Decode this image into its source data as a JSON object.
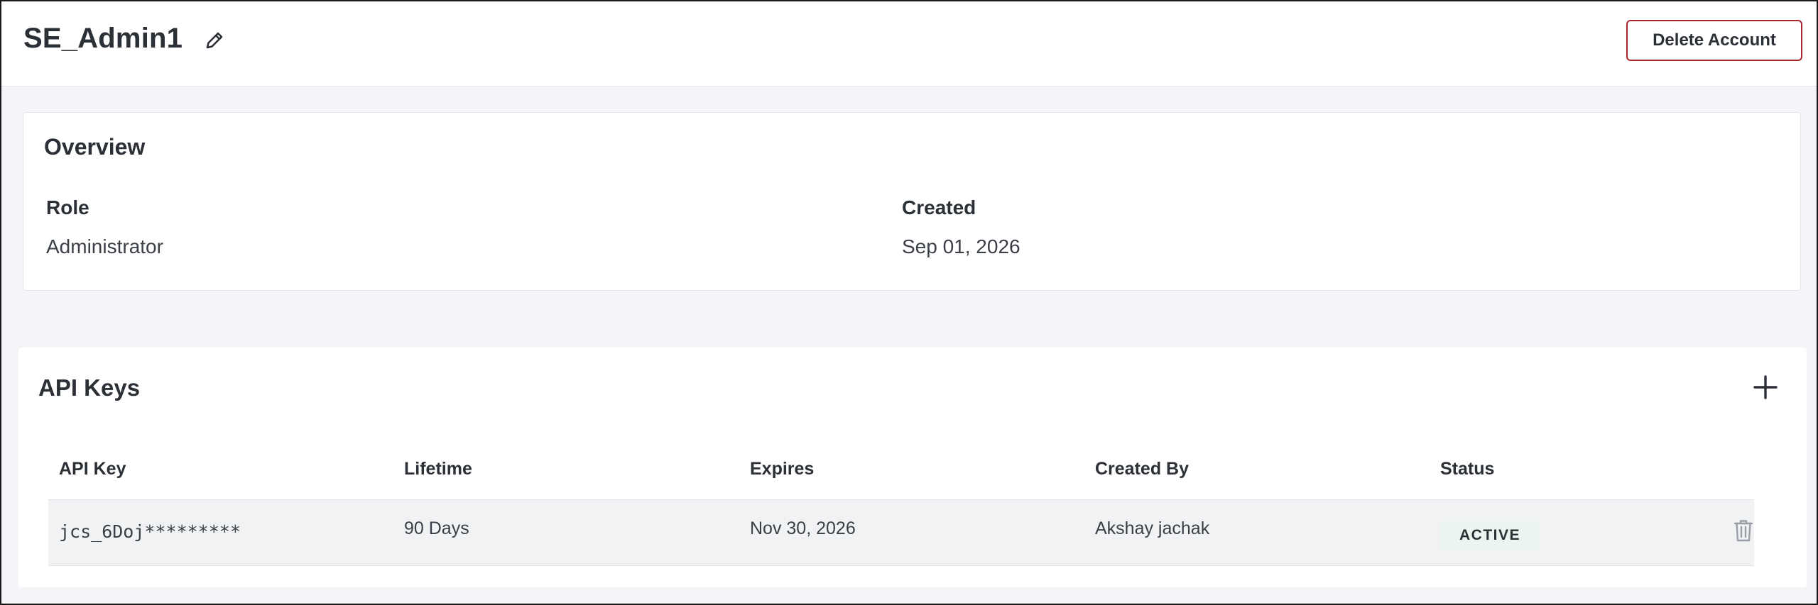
{
  "header": {
    "title": "SE_Admin1",
    "delete_label": "Delete Account"
  },
  "overview": {
    "title": "Overview",
    "role_label": "Role",
    "role_value": "Administrator",
    "created_label": "Created",
    "created_value": "Sep 01, 2026"
  },
  "api_keys": {
    "title": "API Keys",
    "columns": [
      "API Key",
      "Lifetime",
      "Expires",
      "Created By",
      "Status"
    ],
    "rows": [
      {
        "api_key": "jcs_6Doj*********",
        "lifetime": "90 Days",
        "expires": "Nov 30, 2026",
        "created_by": "Akshay jachak",
        "status": "ACTIVE"
      }
    ]
  },
  "icons": {
    "edit": "pencil-icon",
    "add": "plus-icon",
    "delete_row": "trash-icon"
  },
  "colors": {
    "danger_border": "#a8262d",
    "status_bg": "#e9f5ee",
    "page_bg": "#f5f5f9"
  }
}
